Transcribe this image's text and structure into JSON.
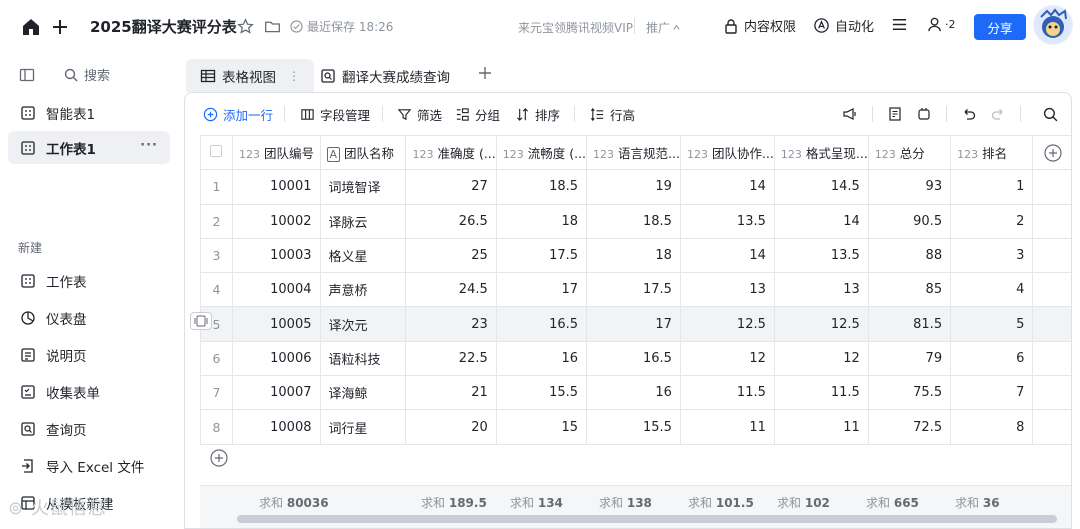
{
  "topbar": {
    "title": "2025翻译大赛评分表",
    "saved_text": "最近保存 18:26",
    "vip_text": "来元宝领腾讯视频VIP",
    "promo_text": "推广",
    "permission_label": "内容权限",
    "automation_label": "自动化",
    "collab_count": "2",
    "share_label": "分享"
  },
  "sidebar": {
    "search_label": "搜索",
    "tables": [
      {
        "label": "智能表1"
      },
      {
        "label": "工作表1",
        "active": true
      }
    ],
    "new_section_label": "新建",
    "new_items": [
      {
        "label": "工作表",
        "icon": "sheet-icon"
      },
      {
        "label": "仪表盘",
        "icon": "dashboard-icon"
      },
      {
        "label": "说明页",
        "icon": "doc-page-icon"
      },
      {
        "label": "收集表单",
        "icon": "form-icon"
      },
      {
        "label": "查询页",
        "icon": "query-icon"
      },
      {
        "label": "导入 Excel 文件",
        "icon": "import-excel-icon"
      },
      {
        "label": "从模板新建",
        "icon": "template-icon"
      }
    ],
    "watermark": "火鼠信息"
  },
  "tabs": [
    {
      "label": "表格视图",
      "active": true
    },
    {
      "label": "翻译大赛成绩查询",
      "active": false
    }
  ],
  "toolbar": {
    "add_row": "添加一行",
    "field_manage": "字段管理",
    "filter": "筛选",
    "group": "分组",
    "sort": "排序",
    "row_height": "行高"
  },
  "grid": {
    "columns": [
      {
        "type": "123",
        "label": "团队编号"
      },
      {
        "type": "A",
        "label": "团队名称"
      },
      {
        "type": "123",
        "label": "准确度 (..."
      },
      {
        "type": "123",
        "label": "流畅度 (..."
      },
      {
        "type": "123",
        "label": "语言规范..."
      },
      {
        "type": "123",
        "label": "团队协作..."
      },
      {
        "type": "123",
        "label": "格式呈现..."
      },
      {
        "type": "123",
        "label": "总分"
      },
      {
        "type": "123",
        "label": "排名"
      }
    ],
    "rows": [
      {
        "idx": "1",
        "cells": [
          "10001",
          "词境智译",
          "27",
          "18.5",
          "19",
          "14",
          "14.5",
          "93",
          "1"
        ]
      },
      {
        "idx": "2",
        "cells": [
          "10002",
          "译脉云",
          "26.5",
          "18",
          "18.5",
          "13.5",
          "14",
          "90.5",
          "2"
        ]
      },
      {
        "idx": "3",
        "cells": [
          "10003",
          "格义星",
          "25",
          "17.5",
          "18",
          "14",
          "13.5",
          "88",
          "3"
        ]
      },
      {
        "idx": "4",
        "cells": [
          "10004",
          "声意桥",
          "24.5",
          "17",
          "17.5",
          "13",
          "13",
          "85",
          "4"
        ]
      },
      {
        "idx": "5",
        "cells": [
          "10005",
          "译次元",
          "23",
          "16.5",
          "17",
          "12.5",
          "12.5",
          "81.5",
          "5"
        ]
      },
      {
        "idx": "6",
        "cells": [
          "10006",
          "语粒科技",
          "22.5",
          "16",
          "16.5",
          "12",
          "12",
          "79",
          "6"
        ]
      },
      {
        "idx": "7",
        "cells": [
          "10007",
          "译海鲸",
          "21",
          "15.5",
          "16",
          "11.5",
          "11.5",
          "75.5",
          "7"
        ]
      },
      {
        "idx": "8",
        "cells": [
          "10008",
          "词行星",
          "20",
          "15",
          "15.5",
          "11",
          "11",
          "72.5",
          "8"
        ]
      }
    ],
    "sums": [
      {
        "label": "求和",
        "value": "80036"
      },
      {
        "label": "",
        "value": ""
      },
      {
        "label": "求和",
        "value": "189.5"
      },
      {
        "label": "求和",
        "value": "134"
      },
      {
        "label": "求和",
        "value": "138"
      },
      {
        "label": "求和",
        "value": "101.5"
      },
      {
        "label": "求和",
        "value": "102"
      },
      {
        "label": "求和",
        "value": "665"
      },
      {
        "label": "求和",
        "value": "36"
      }
    ]
  },
  "colors": {
    "accent": "#1d6af6",
    "highlight_row": "#f2f3f5",
    "border": "#e4e6ea"
  }
}
